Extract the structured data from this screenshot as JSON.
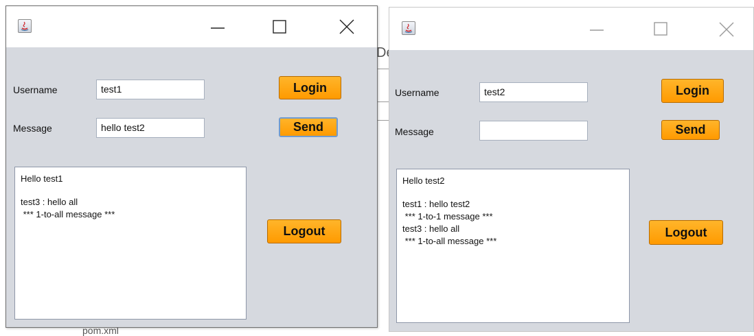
{
  "background": {
    "fragment_de": "De",
    "fragment_file": "pom.xml"
  },
  "window_left": {
    "controls": {
      "minimize": "minimize-icon",
      "maximize": "maximize-icon",
      "close": "close-icon"
    },
    "username_label": "Username",
    "username_value": "test1",
    "message_label": "Message",
    "message_value": "hello test2",
    "login_label": "Login",
    "send_label": "Send",
    "logout_label": "Logout",
    "chat_lines": [
      {
        "text": "Hello test1",
        "gap_after": true
      },
      {
        "text": "test3 : hello all"
      },
      {
        "text": " *** 1-to-all message ***"
      }
    ]
  },
  "window_right": {
    "controls": {
      "minimize": "minimize-icon",
      "maximize": "maximize-icon",
      "close": "close-icon"
    },
    "username_label": "Username",
    "username_value": "test2",
    "message_label": "Message",
    "message_value": "",
    "login_label": "Login",
    "send_label": "Send",
    "logout_label": "Logout",
    "chat_lines": [
      {
        "text": "Hello test2",
        "gap_after": true
      },
      {
        "text": "test1 : hello test2"
      },
      {
        "text": " *** 1-to-1 message ***"
      },
      {
        "text": "test3 : hello all"
      },
      {
        "text": " *** 1-to-all message ***"
      }
    ]
  },
  "colors": {
    "window_bg": "#d6d9df",
    "button_orange": "#ff9f0a",
    "titlebar": "#ffffff"
  }
}
